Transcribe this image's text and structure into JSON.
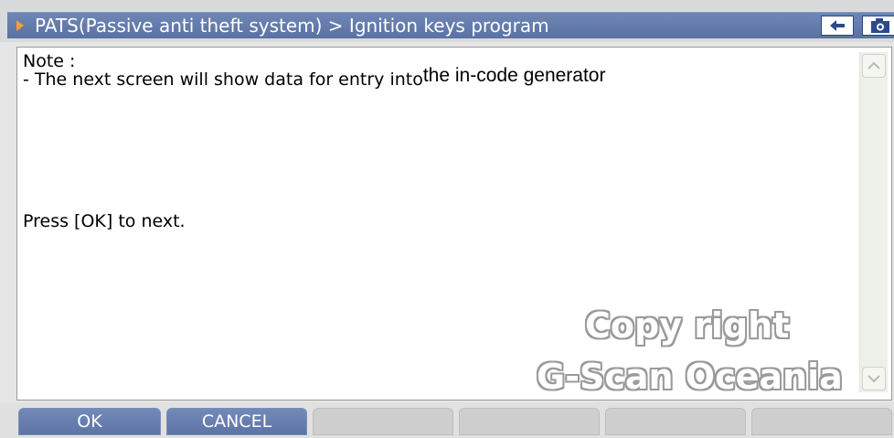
{
  "window": {
    "title": "PATS(Passive anti theft system) > Ignition keys program",
    "back_icon": "back-arrow-icon",
    "camera_icon": "camera-icon"
  },
  "content": {
    "note_label": "Note :",
    "line_prefix": "- The next screen will show data for entry into",
    "line_suffix": "the in-code generator",
    "instruction": "Press [OK] to next."
  },
  "watermark": {
    "line1": "Copy right",
    "line2": "G-Scan Oceania"
  },
  "buttons": {
    "ok": "OK",
    "cancel": "CANCEL"
  },
  "colors": {
    "titlebar": "#5f77a8",
    "accent_arrow": "#f3a03a",
    "button_active": "#6680b2"
  }
}
